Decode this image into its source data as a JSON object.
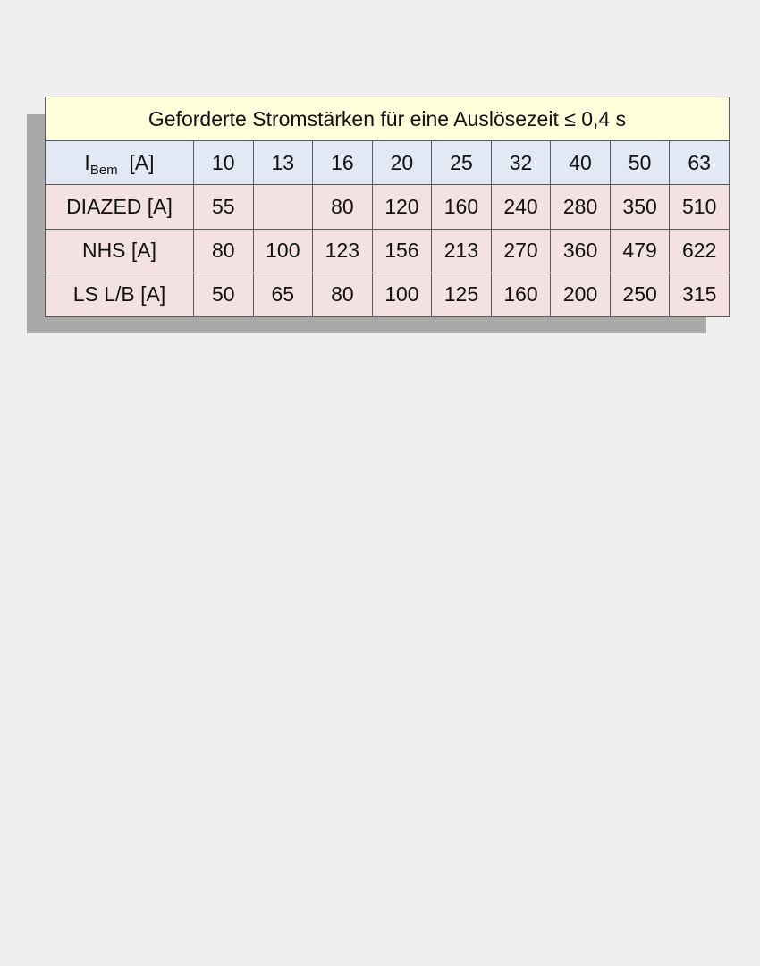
{
  "title": "Geforderte Stromstärken für eine Auslösezeit ≤ 0,4 s",
  "header": {
    "label_main": "I",
    "label_sub": "Bem",
    "label_unit": "[A]",
    "values": [
      "10",
      "13",
      "16",
      "20",
      "25",
      "32",
      "40",
      "50",
      "63"
    ]
  },
  "rows": [
    {
      "label": "DIAZED  [A]",
      "values": [
        "55",
        "",
        "80",
        "120",
        "160",
        "240",
        "280",
        "350",
        "510"
      ]
    },
    {
      "label": "NHS  [A]",
      "values": [
        "80",
        "100",
        "123",
        "156",
        "213",
        "270",
        "360",
        "479",
        "622"
      ]
    },
    {
      "label": "LS L/B  [A]",
      "values": [
        "50",
        "65",
        "80",
        "100",
        "125",
        "160",
        "200",
        "250",
        "315"
      ]
    }
  ],
  "colors": {
    "title_bg": "#ffffdc",
    "header_bg": "#e2e9f4",
    "data_bg": "#f4e2e2",
    "shadow": "#a9a9a9",
    "page_bg": "#efefef"
  }
}
